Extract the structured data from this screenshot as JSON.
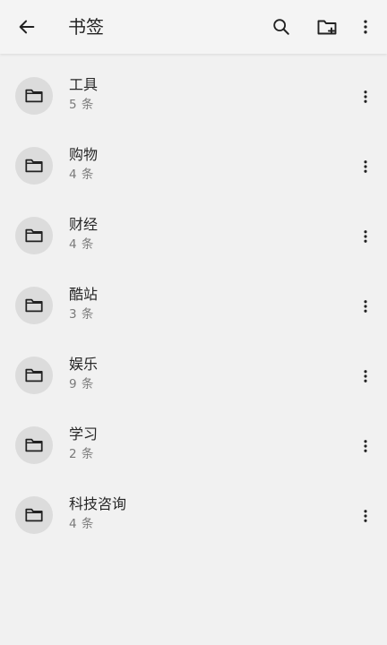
{
  "header": {
    "title": "书签",
    "icons": {
      "back": "arrow-left-icon",
      "search": "search-icon",
      "new_folder": "folder-plus-icon",
      "more": "more-vertical-icon"
    }
  },
  "folders": [
    {
      "name": "工具",
      "count": "5 条"
    },
    {
      "name": "购物",
      "count": "4 条"
    },
    {
      "name": "财经",
      "count": "4 条"
    },
    {
      "name": "酷站",
      "count": "3 条"
    },
    {
      "name": "娱乐",
      "count": "9 条"
    },
    {
      "name": "学习",
      "count": "2 条"
    },
    {
      "name": "科技咨询",
      "count": "4 条"
    }
  ],
  "colors": {
    "background": "#f1f1f1",
    "avatar": "#dcdcdc",
    "text_primary": "#262626",
    "text_secondary": "#7a7a7a"
  }
}
